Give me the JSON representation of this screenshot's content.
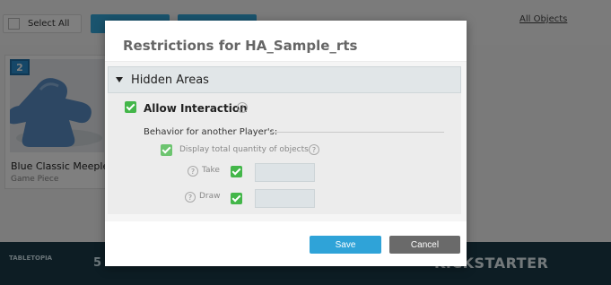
{
  "background": {
    "select_all_label": "Select All",
    "all_objects_link": "All Objects",
    "card": {
      "badge": "2",
      "title": "Blue Classic Meeple",
      "subtitle": "Game Piece"
    },
    "banner": {
      "logo_text": "TABLETOPIA",
      "headline": "5 STEPS TO BOOST YOUR KICKSTARTER CAMPAIGN",
      "brand": "KICKSTARTER"
    }
  },
  "dialog": {
    "title": "Restrictions for HA_Sample_rts",
    "section_title": "Hidden Areas",
    "allow_interaction": {
      "label": "Allow Interaction",
      "checked": true
    },
    "behavior_label": "Behavior for another Player's:",
    "display_quantity": {
      "label": "Display total quantity of objects",
      "checked": true
    },
    "take": {
      "label": "Take",
      "checked": true,
      "value": ""
    },
    "draw": {
      "label": "Draw",
      "checked": true,
      "value": ""
    },
    "help_glyph": "?",
    "save_label": "Save",
    "cancel_label": "Cancel"
  },
  "colors": {
    "accent": "#2fa3d8",
    "checkbox_green": "#43b649",
    "cancel_gray": "#6a6a6a",
    "banner_bg": "#1a3a48"
  }
}
